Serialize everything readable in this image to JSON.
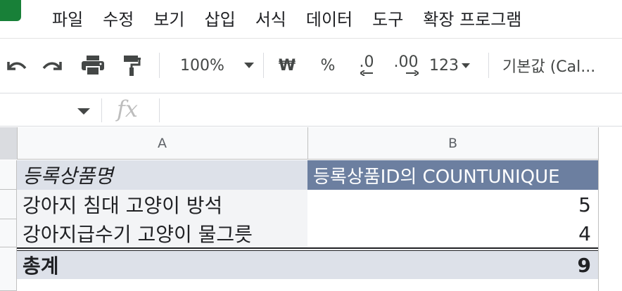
{
  "menu": {
    "items": [
      "파일",
      "수정",
      "보기",
      "삽입",
      "서식",
      "데이터",
      "도구",
      "확장 프로그램"
    ]
  },
  "toolbar": {
    "zoom": "100%",
    "currency": "₩",
    "percent": "%",
    "decrease_decimal": ".0",
    "increase_decimal": ".00",
    "number_format": "123",
    "font": "기본값 (Cal..."
  },
  "formula_bar": {
    "name_box": "",
    "fx": "fx",
    "value": ""
  },
  "grid": {
    "columns": [
      "A",
      "B"
    ],
    "header_row": {
      "a": "등록상품명",
      "b": "등록상품ID의 COUNTUNIQUE"
    },
    "rows": [
      {
        "a": "강아지 침대 고양이 방석",
        "b": "5"
      },
      {
        "a": "강아지급수기 고양이 물그릇",
        "b": "4"
      }
    ],
    "total_row": {
      "a": "총계",
      "b": "9"
    }
  },
  "colors": {
    "header_a_bg": "#dde1e9",
    "header_b_bg": "#6c7fa0",
    "row_a_bg": "#f3f4f6",
    "total_bg": "#dde1e9",
    "brand_green": "#188038"
  }
}
